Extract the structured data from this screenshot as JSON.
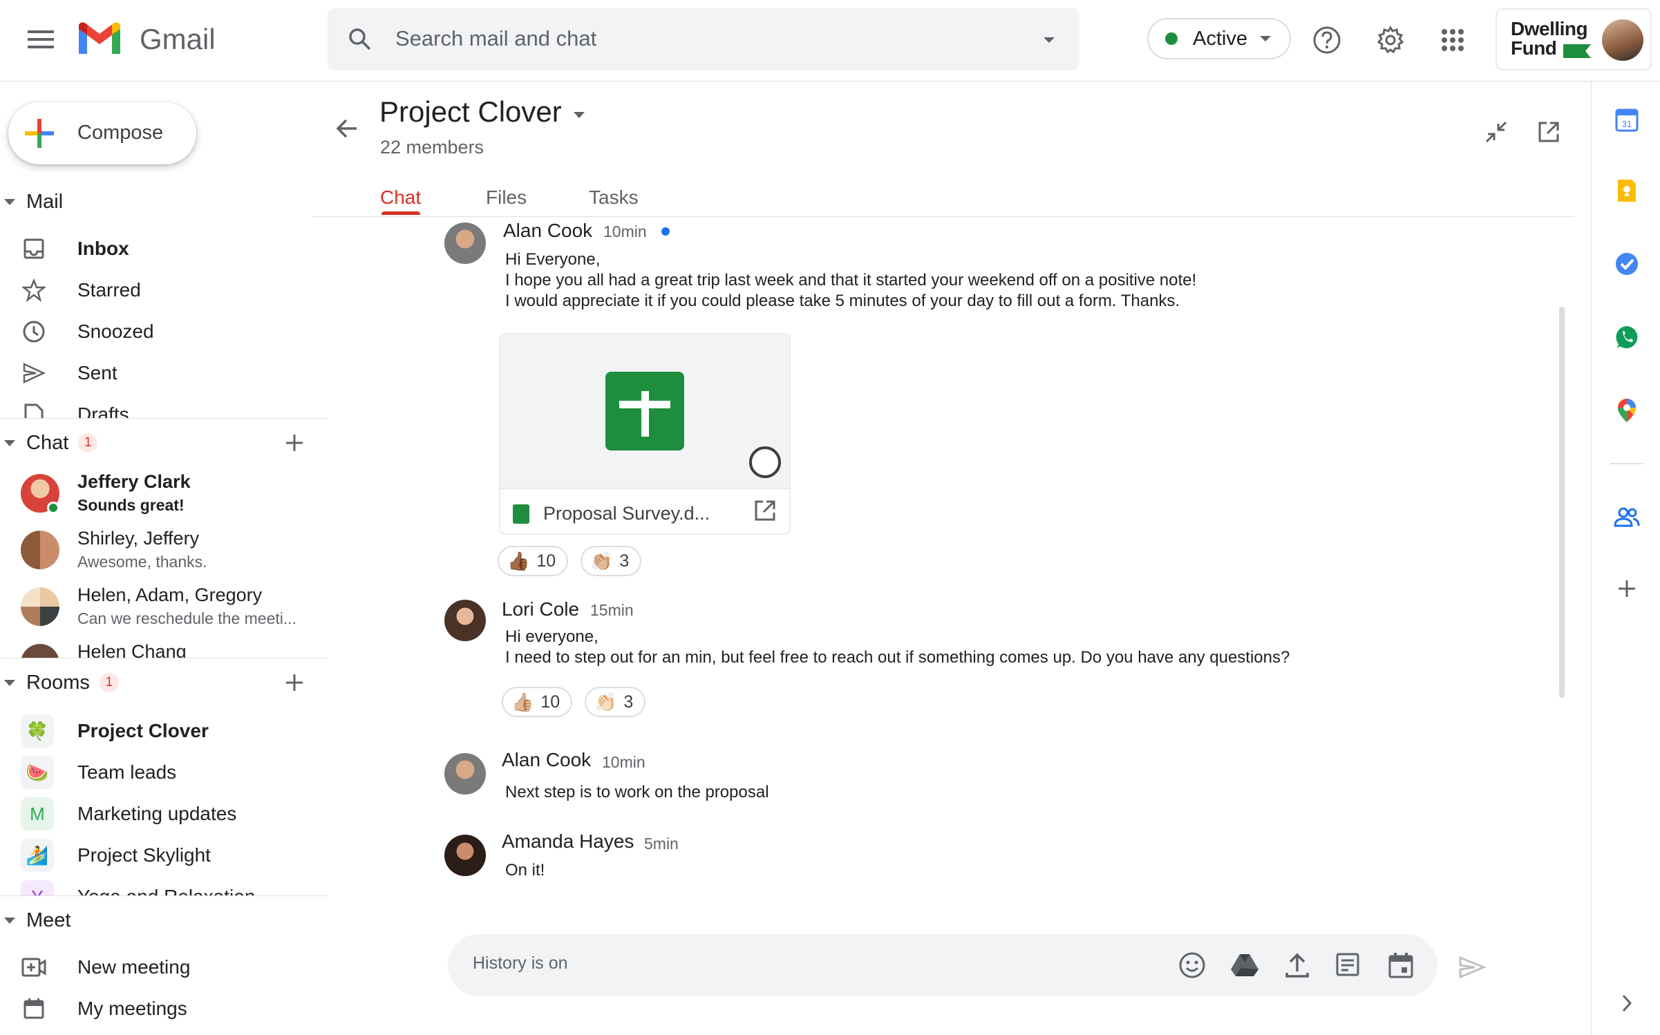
{
  "app": {
    "name": "Gmail"
  },
  "search": {
    "placeholder": "Search mail and chat"
  },
  "status": {
    "label": "Active",
    "color": "#1e8e3e"
  },
  "account": {
    "org_line1": "Dwelling",
    "org_line2": "Fund"
  },
  "compose": {
    "label": "Compose"
  },
  "mail": {
    "label": "Mail",
    "items": [
      {
        "label": "Inbox",
        "icon": "inbox-icon"
      },
      {
        "label": "Starred",
        "icon": "star-icon"
      },
      {
        "label": "Snoozed",
        "icon": "clock-icon"
      },
      {
        "label": "Sent",
        "icon": "send-icon"
      },
      {
        "label": "Drafts",
        "icon": "draft-icon"
      }
    ]
  },
  "chat": {
    "label": "Chat",
    "badge": "1",
    "items": [
      {
        "name": "Jeffery Clark",
        "snippet": "Sounds great!"
      },
      {
        "name": "Shirley, Jeffery",
        "snippet": "Awesome, thanks."
      },
      {
        "name": "Helen, Adam, Gregory",
        "snippet": "Can we reschedule the meeti..."
      },
      {
        "name": "Helen Chang",
        "snippet": ""
      }
    ]
  },
  "rooms": {
    "label": "Rooms",
    "badge": "1",
    "items": [
      {
        "label": "Project Clover",
        "icon": "🍀"
      },
      {
        "label": "Team leads",
        "icon": "🍉"
      },
      {
        "label": "Marketing updates",
        "icon": "M"
      },
      {
        "label": "Project Skylight",
        "icon": "🏄"
      },
      {
        "label": "Yoga and Relaxation",
        "icon": "Y"
      }
    ]
  },
  "meet": {
    "label": "Meet",
    "items": [
      {
        "label": "New meeting",
        "icon": "video-add-icon"
      },
      {
        "label": "My meetings",
        "icon": "calendar-icon"
      }
    ]
  },
  "room": {
    "title": "Project Clover",
    "members": "22 members",
    "tabs": [
      "Chat",
      "Files",
      "Tasks"
    ]
  },
  "messages": [
    {
      "author": "Alan Cook",
      "time": "10min",
      "lines": [
        "Hi Everyone,",
        "I hope you all had a great trip last week and that it started your weekend off on a positive note!",
        "I would appreciate it if you could please take 5 minutes of your day to fill out a form. Thanks."
      ],
      "attachment": {
        "name": "Proposal Survey.d..."
      },
      "reactions": [
        {
          "emoji": "👍🏾",
          "count": "10"
        },
        {
          "emoji": "👏🏼",
          "count": "3"
        }
      ]
    },
    {
      "author": "Lori Cole",
      "time": "15min",
      "lines": [
        "Hi everyone,",
        "I need to step out for an min, but feel free to reach out if something comes up.  Do you have any questions?"
      ],
      "reactions": [
        {
          "emoji": "👍🏼",
          "count": "10"
        },
        {
          "emoji": "👏🏻",
          "count": "3"
        }
      ]
    },
    {
      "author": "Alan Cook",
      "time": "10min",
      "lines": [
        "Next step is to work on the proposal"
      ]
    },
    {
      "author": "Amanda Hayes",
      "time": "5min",
      "lines": [
        "On it!"
      ]
    }
  ],
  "composer": {
    "placeholder": "History is on"
  },
  "colors": {
    "accent": "#d93025",
    "google_green": "#1e8e3e",
    "google_blue": "#1a73e8"
  }
}
